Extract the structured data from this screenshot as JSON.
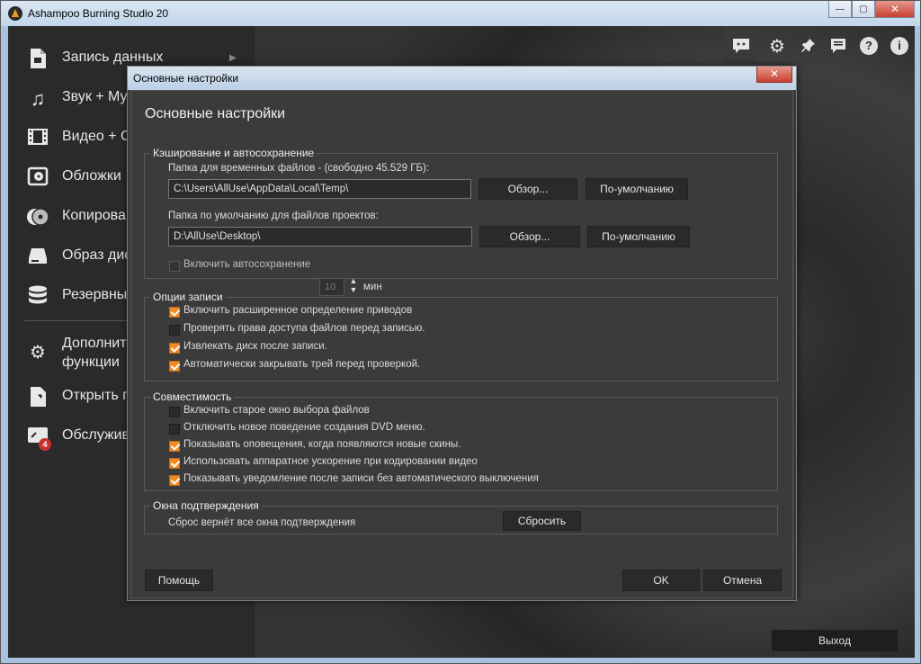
{
  "window": {
    "title": "Ashampoo Burning Studio 20",
    "controls": [
      "—",
      "▢",
      "✕"
    ]
  },
  "sidebar": {
    "items": [
      {
        "label": "Запись данных",
        "icon": "file-icon"
      },
      {
        "label": "Звук + Му",
        "icon": "music-note-icon"
      },
      {
        "label": "Видео + С",
        "icon": "film-icon"
      },
      {
        "label": "Обложки",
        "icon": "cover-icon"
      },
      {
        "label": "Копирова",
        "icon": "disc-copy-icon"
      },
      {
        "label": "Образ дис",
        "icon": "drive-icon"
      },
      {
        "label": "Резервны",
        "icon": "database-icon"
      },
      {
        "label": "Дополнит\nфункции",
        "icon": "gears-icon"
      },
      {
        "label": "Открыть п",
        "icon": "wrench-icon"
      },
      {
        "label": "Обслужив",
        "icon": "service-icon",
        "badge": "4"
      }
    ]
  },
  "toolbar": {
    "icons": [
      "chat-icon",
      "gear-icon",
      "pin-icon",
      "comment-icon",
      "help-icon",
      "info-icon"
    ],
    "help_glyph": "?",
    "info_glyph": "i"
  },
  "exit_button": "Выход",
  "dialog": {
    "window_title": "Основные настройки",
    "close_glyph": "✕",
    "heading": "Основные настройки",
    "caching": {
      "group_label": "Кэширование и автосохранение",
      "temp_folder_label": "Папка для временных файлов - (свободно 45.529  ГБ):",
      "temp_folder_value": "C:\\Users\\AllUse\\AppData\\Local\\Temp\\",
      "project_folder_label": "Папка по умолчанию для файлов проектов:",
      "project_folder_value": "D:\\AllUse\\Desktop\\",
      "browse": "Обзор...",
      "default": "По-умолчанию",
      "autosave_label": "Включить автосохранение",
      "autosave_checked": false,
      "autosave_minutes": "10",
      "minutes_unit": "мин"
    },
    "write_options": {
      "group_label": "Опции записи",
      "items": [
        {
          "label": "Включить расширенное определение приводов",
          "checked": true
        },
        {
          "label": "Проверять права доступа файлов перед записью.",
          "checked": false
        },
        {
          "label": "Извлекать диск после записи.",
          "checked": true
        },
        {
          "label": "Автоматически закрывать трей перед проверкой.",
          "checked": true
        }
      ]
    },
    "compat": {
      "group_label": "Совместимость",
      "items": [
        {
          "label": "Включить старое окно выбора файлов",
          "checked": false
        },
        {
          "label": "Отключить новое поведение создания DVD меню.",
          "checked": false
        },
        {
          "label": "Показывать оповещения, когда появляются новые скины.",
          "checked": true
        },
        {
          "label": "Использовать аппаратное ускорение при кодировании видео",
          "checked": true
        },
        {
          "label": "Показывать уведомление после записи без автоматического выключения",
          "checked": true
        }
      ]
    },
    "confirm": {
      "group_label": "Окна подтверждения",
      "description": "Сброс вернёт все окна подтверждения",
      "reset": "Сбросить"
    },
    "help_button": "Помощь",
    "ok_button": "OK",
    "cancel_button": "Отмена"
  }
}
